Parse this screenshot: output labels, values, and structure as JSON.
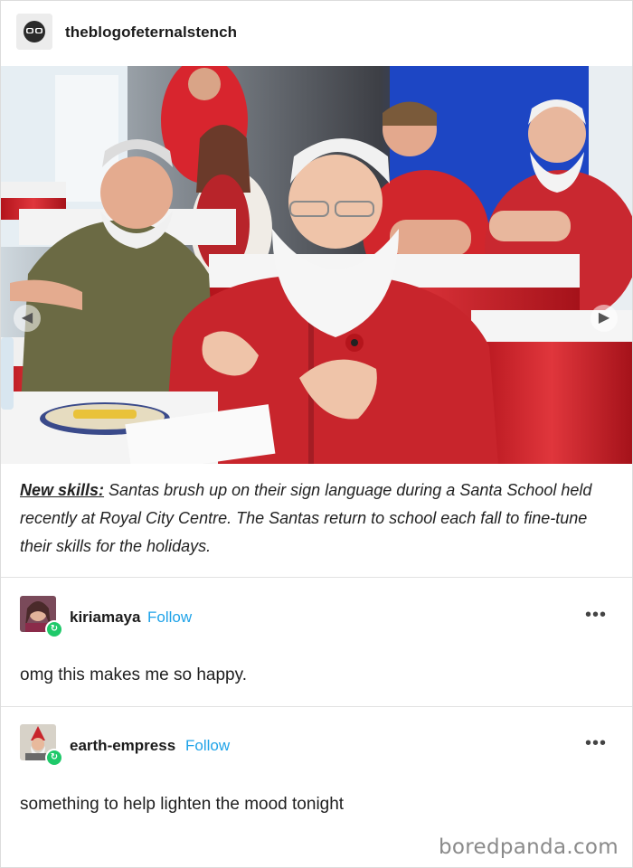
{
  "post": {
    "blog_name": "theblogofeternalstench",
    "caption_lead": "New skills:",
    "caption_text": " Santas brush up on their sign language during a Santa School held recently at Royal City Centre. The Santas return to school each fall to fine-tune their skills for the holidays."
  },
  "photo": {
    "prev_icon": "chevron-left-icon",
    "next_icon": "chevron-right-icon"
  },
  "reblogs": [
    {
      "username": "kiriamaya",
      "follow_label": "Follow",
      "more_label": "•••",
      "text": "omg this makes me so happy."
    },
    {
      "username": "earth-empress",
      "follow_label": "Follow",
      "more_label": "•••",
      "text": "something to help lighten the mood tonight"
    }
  ],
  "watermark": "boredpanda.com",
  "colors": {
    "follow": "#1fa3e8",
    "reblog_badge": "#1fc96a",
    "santa_red": "#c8252c"
  }
}
